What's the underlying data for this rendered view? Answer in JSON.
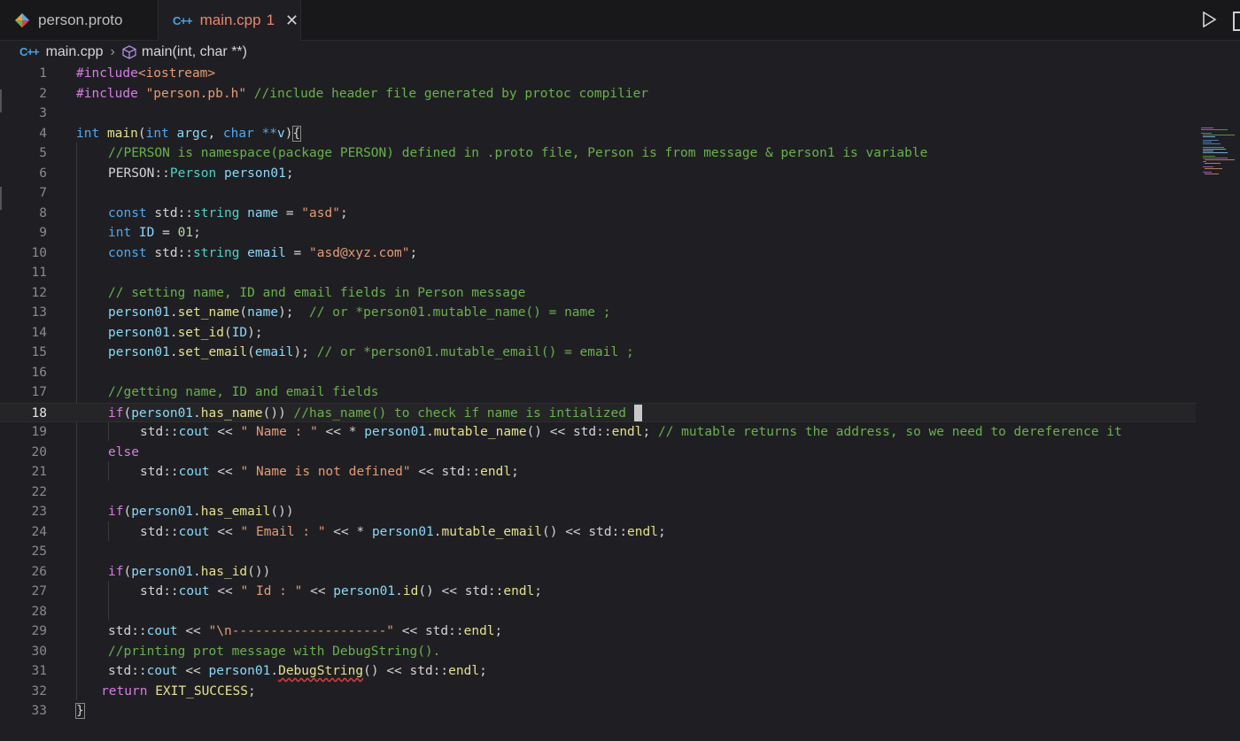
{
  "tabs": [
    {
      "label": "person.proto",
      "icon": "proto-file-icon"
    },
    {
      "label": "main.cpp",
      "badge": "1",
      "icon": "cpp-file-icon",
      "close": "✕"
    }
  ],
  "breadcrumb": {
    "file": "main.cpp",
    "symbol": "main(int, char **)"
  },
  "editor": {
    "active_line": 18,
    "line_numbers": [
      "1",
      "2",
      "3",
      "4",
      "5",
      "6",
      "7",
      "8",
      "9",
      "10",
      "11",
      "12",
      "13",
      "14",
      "15",
      "16",
      "17",
      "18",
      "19",
      "20",
      "21",
      "22",
      "23",
      "24",
      "25",
      "26",
      "27",
      "28",
      "29",
      "30",
      "31",
      "32",
      "33"
    ]
  },
  "colors": {
    "background": "#1f1f23",
    "keyword": "#d67de0",
    "type": "#4fa8f0",
    "function": "#e5e08c",
    "variable": "#8ad8f8",
    "string": "#e59a76",
    "comment": "#6ab04c",
    "tab_active_text": "#e8866e"
  },
  "code": {
    "l1": {
      "a": "#include",
      "b": "<iostream>"
    },
    "l2": {
      "a": "#include ",
      "b": "\"person.pb.h\"",
      "c": " //include header file generated by protoc compilier"
    },
    "l4": {
      "a": "int",
      "b": " ",
      "c": "main",
      "d": "(",
      "e": "int",
      "f": " argc",
      "g": ", ",
      "h": "char",
      "i": " ",
      "j": "**",
      "k": "v",
      "l": ")",
      "m": "{"
    },
    "l5": "//PERSON is namespace(package PERSON) defined in .proto file, Person is from message & person1 is variable",
    "l6": {
      "a": "PERSON",
      "b": "::",
      "c": "Person",
      "d": " person01",
      "e": ";"
    },
    "l8": {
      "a": "const",
      "b": " std",
      "c": "::",
      "d": "string",
      "e": " name",
      "f": " = ",
      "g": "\"asd\"",
      "h": ";"
    },
    "l9": {
      "a": "int",
      "b": " ID",
      "c": " = ",
      "d": "01",
      "e": ";"
    },
    "l10": {
      "a": "const",
      "b": " std",
      "c": "::",
      "d": "string",
      "e": " email",
      "f": " = ",
      "g": "\"asd@xyz.com\"",
      "h": ";"
    },
    "l12": "// setting name, ID and email fields in Person message",
    "l13": {
      "a": "person01",
      "b": ".",
      "c": "set_name",
      "d": "(",
      "e": "name",
      "f": ");  ",
      "g": "// or *person01.mutable_name() = name ;"
    },
    "l14": {
      "a": "person01",
      "b": ".",
      "c": "set_id",
      "d": "(",
      "e": "ID",
      "f": ");"
    },
    "l15": {
      "a": "person01",
      "b": ".",
      "c": "set_email",
      "d": "(",
      "e": "email",
      "f": "); ",
      "g": "// or *person01.mutable_email() = email ;"
    },
    "l17": "//getting name, ID and email fields",
    "l18": {
      "a": "if",
      "b": "(",
      "c": "person01",
      "d": ".",
      "e": "has_name",
      "f": "()) ",
      "g": "//has_name() to check if name is intialized "
    },
    "l19": {
      "a": "std",
      "b": "::",
      "c": "cout",
      "d": " << ",
      "e": "\" Name : \"",
      "f": " << * ",
      "g": "person01",
      "h": ".",
      "i": "mutable_name",
      "j": "() << std::",
      "k": "endl",
      "l": "; ",
      "m": "// mutable returns the address, so we need to dereference it"
    },
    "l20": "else",
    "l21": {
      "a": "std",
      "b": "::",
      "c": "cout",
      "d": " << ",
      "e": "\" Name is not defined\"",
      "f": " << std::",
      "g": "endl",
      "h": ";"
    },
    "l23": {
      "a": "if",
      "b": "(",
      "c": "person01",
      "d": ".",
      "e": "has_email",
      "f": "())"
    },
    "l24": {
      "a": "std",
      "b": "::",
      "c": "cout",
      "d": " << ",
      "e": "\" Email : \"",
      "f": " << * ",
      "g": "person01",
      "h": ".",
      "i": "mutable_email",
      "j": "() << std::",
      "k": "endl",
      "l": ";"
    },
    "l26": {
      "a": "if",
      "b": "(",
      "c": "person01",
      "d": ".",
      "e": "has_id",
      "f": "())"
    },
    "l27": {
      "a": "std",
      "b": "::",
      "c": "cout",
      "d": " << ",
      "e": "\" Id : \"",
      "f": " << ",
      "g": "person01",
      "h": ".",
      "i": "id",
      "j": "() << std::",
      "k": "endl",
      "l": ";"
    },
    "l29": {
      "a": "std",
      "b": "::",
      "c": "cout",
      "d": " << ",
      "e": "\"\\n--------------------\"",
      "f": " << std::",
      "g": "endl",
      "h": ";"
    },
    "l30": "//printing prot message with DebugString().",
    "l31": {
      "a": "std",
      "b": "::",
      "c": "cout",
      "d": " << ",
      "e": "person01",
      "f": ".",
      "g": "DebugString",
      "h": "() << std::",
      "i": "endl",
      "j": ";"
    },
    "l32": {
      "a": "return",
      "b": " ",
      "c": "EXIT_SUCCESS",
      "d": ";"
    },
    "l33": "}"
  }
}
